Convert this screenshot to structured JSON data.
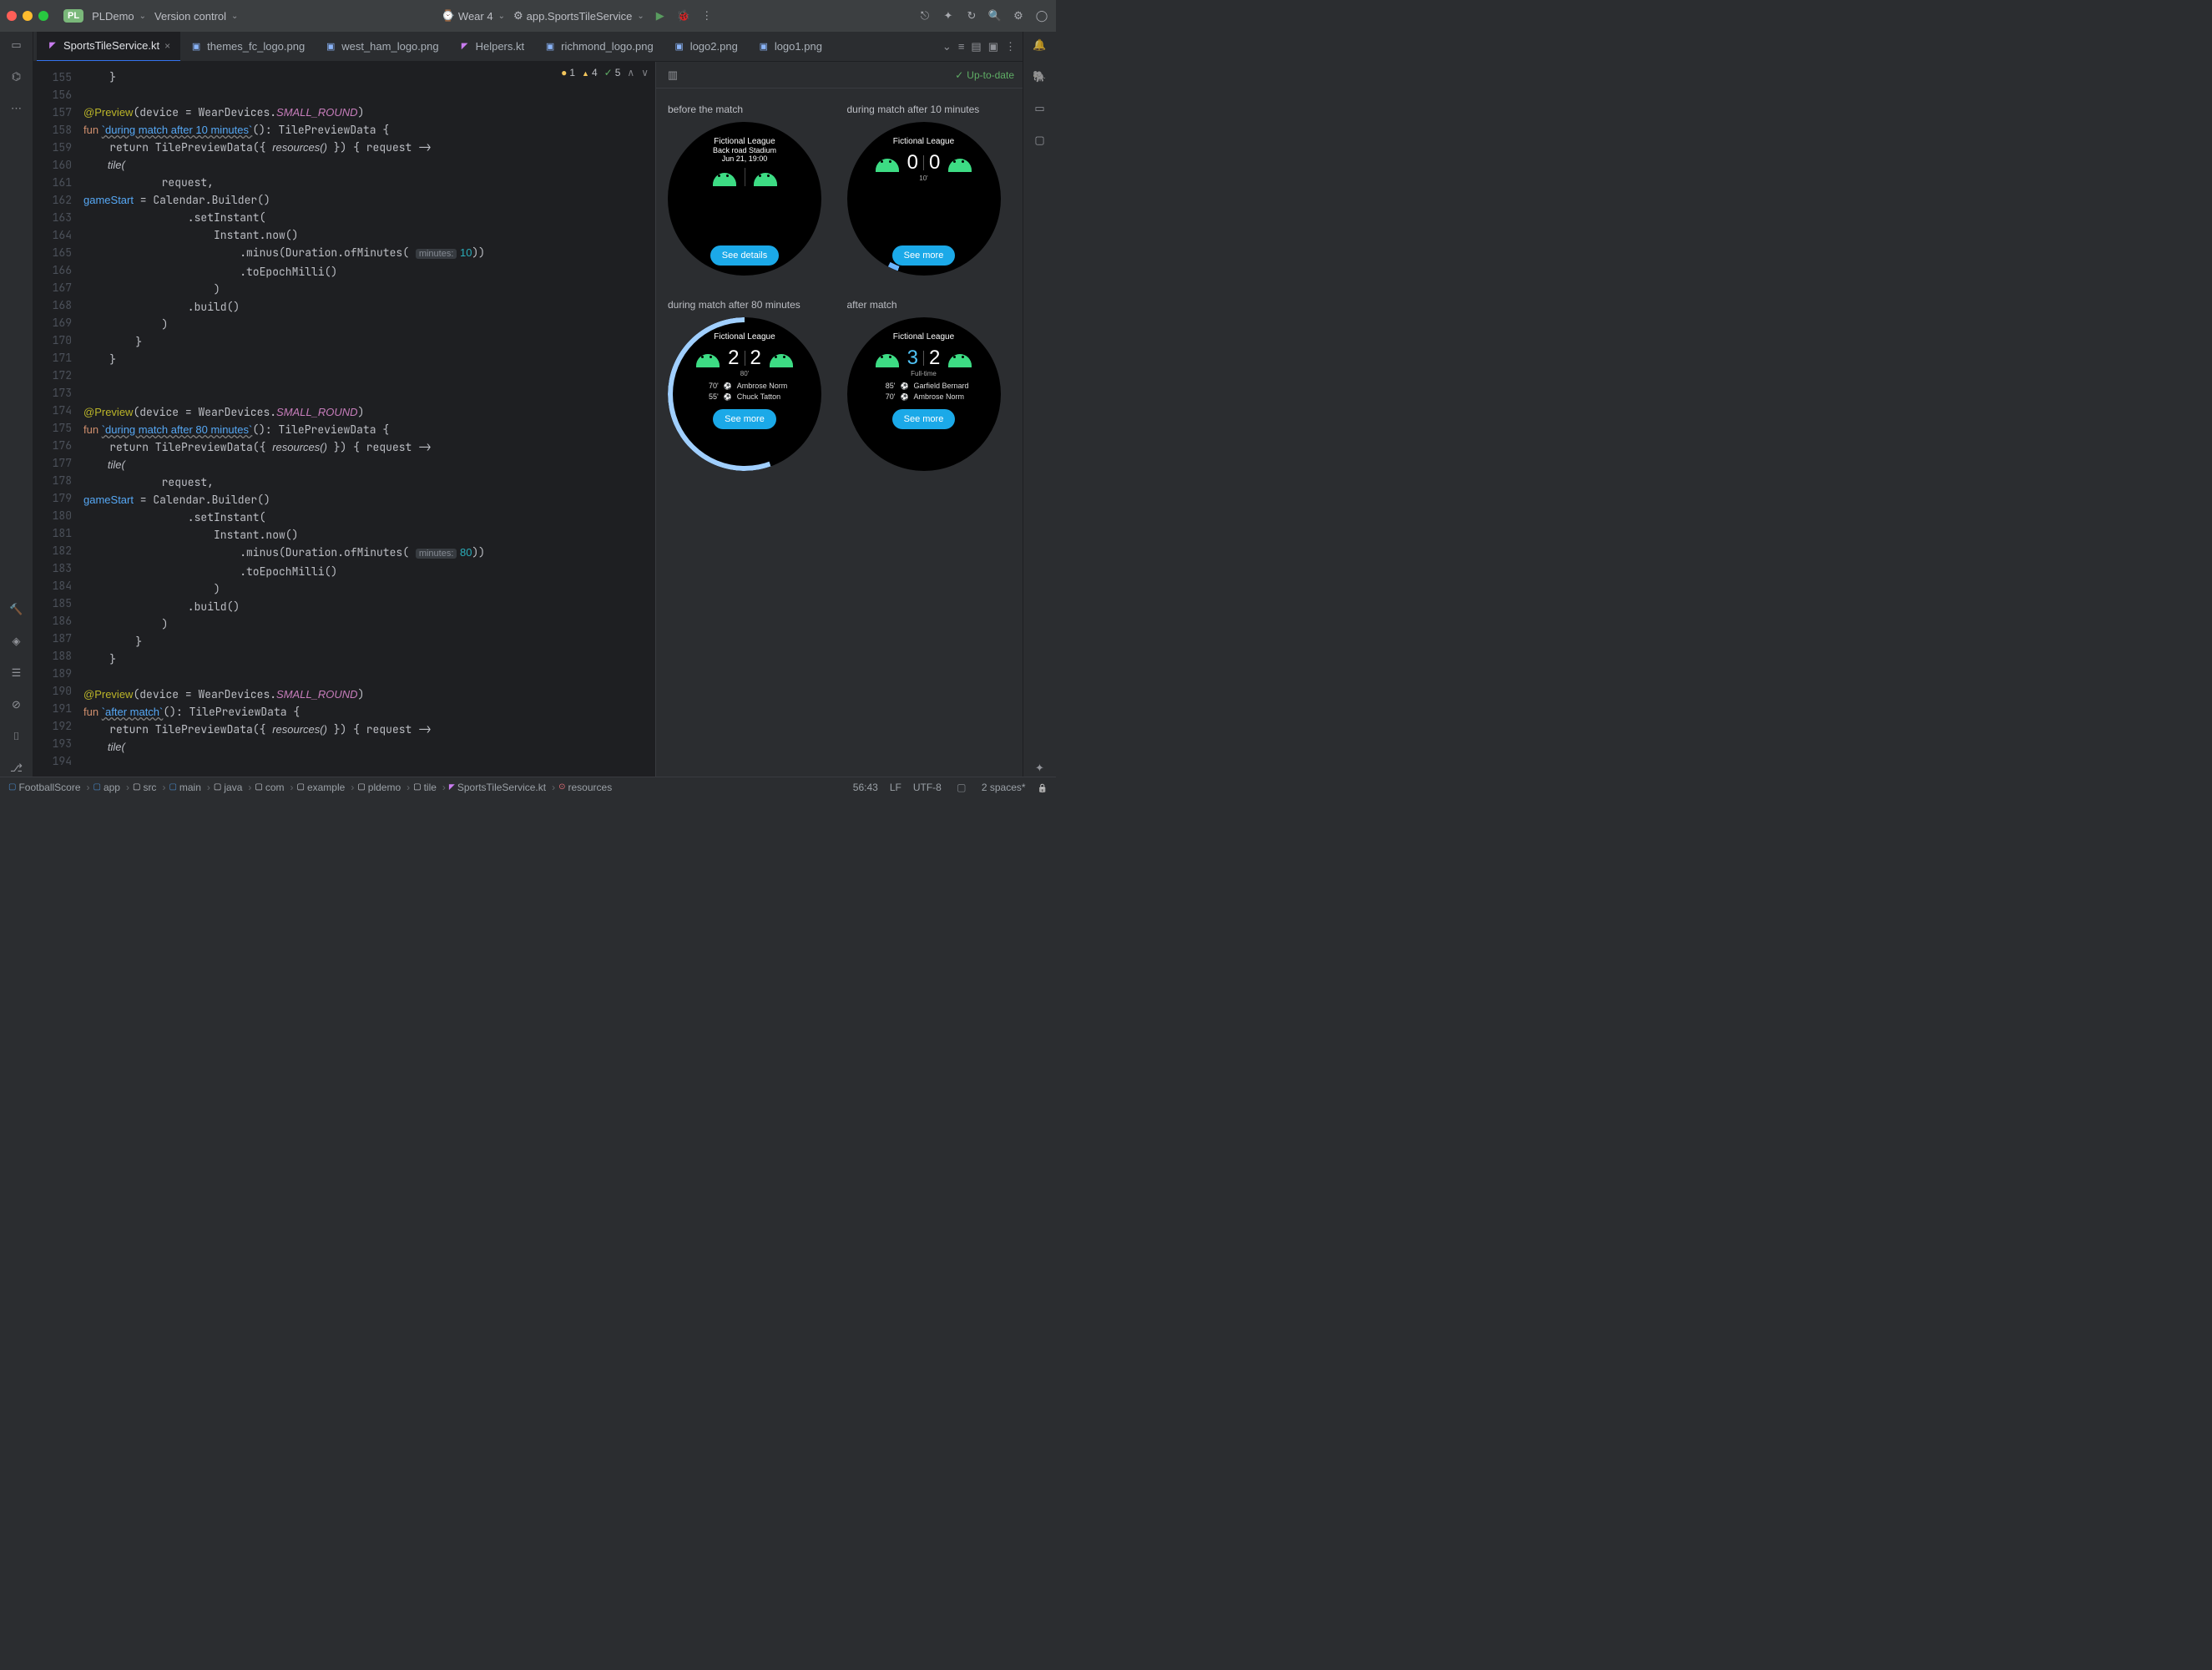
{
  "toolbar": {
    "project_badge": "PL",
    "project_name": "PLDemo",
    "vcs": "Version control",
    "device": "Wear 4",
    "run_config": "app.SportsTileService"
  },
  "tabs": [
    {
      "label": "SportsTileService.kt",
      "type": "kt",
      "active": true,
      "closeable": true
    },
    {
      "label": "themes_fc_logo.png",
      "type": "img"
    },
    {
      "label": "west_ham_logo.png",
      "type": "img"
    },
    {
      "label": "Helpers.kt",
      "type": "kt"
    },
    {
      "label": "richmond_logo.png",
      "type": "img"
    },
    {
      "label": "logo2.png",
      "type": "img"
    },
    {
      "label": "logo1.png",
      "type": "img"
    }
  ],
  "inspections": {
    "err": "1",
    "warn": "4",
    "ok": "5"
  },
  "gutter_start": 155,
  "gutter_end": 194,
  "preview": {
    "status": "Up-to-date",
    "cells": [
      {
        "label": "before the match",
        "league": "Fictional League",
        "stadium": "Back road Stadium",
        "date": "Jun 21, 19:00",
        "btn": "See details",
        "mode": "pre"
      },
      {
        "label": "during match after 10 minutes",
        "league": "Fictional League",
        "score_a": "0",
        "score_b": "0",
        "sub": "10'",
        "btn": "See more",
        "mode": "live",
        "arc": "arc-10"
      },
      {
        "label": "during match after 80 minutes",
        "league": "Fictional League",
        "score_a": "2",
        "score_b": "2",
        "sub": "80'",
        "btn": "See more",
        "mode": "live",
        "arc": "arc-80",
        "goals": [
          {
            "min": "70'",
            "name": "Ambrose Norm"
          },
          {
            "min": "55'",
            "name": "Chuck Tatton"
          }
        ]
      },
      {
        "label": "after match",
        "league": "Fictional League",
        "score_a": "3",
        "score_b": "2",
        "sub": "Full-time",
        "btn": "See more",
        "mode": "post",
        "score_a_class": "score-blue",
        "goals": [
          {
            "min": "85'",
            "name": "Garfield Bernard"
          },
          {
            "min": "70'",
            "name": "Ambrose Norm"
          }
        ]
      }
    ]
  },
  "breadcrumbs": [
    {
      "ic": "sq",
      "label": "FootballScore"
    },
    {
      "ic": "sq",
      "label": "app"
    },
    {
      "ic": "dir",
      "label": "src"
    },
    {
      "ic": "sq",
      "label": "main"
    },
    {
      "ic": "dir",
      "label": "java"
    },
    {
      "ic": "dir",
      "label": "com"
    },
    {
      "ic": "dir",
      "label": "example"
    },
    {
      "ic": "dir",
      "label": "pldemo"
    },
    {
      "ic": "dir",
      "label": "tile"
    },
    {
      "ic": "ktf",
      "label": "SportsTileService.kt"
    },
    {
      "ic": "fnc",
      "label": "resources"
    }
  ],
  "statusbar": {
    "pos": "56:43",
    "sep": "LF",
    "enc": "UTF-8",
    "indent": "2 spaces*"
  },
  "code_literals": {
    "preview_ann": "@Preview",
    "device_arg": "(device = WearDevices.",
    "small_round": "SMALL_ROUND",
    ")": ")",
    "fun": "fun ",
    "fn1": "`during match after 10 minutes`",
    "fn2": "`during match after 80 minutes`",
    "fn3": "`after match`",
    "sig": "(): TilePreviewData {",
    "return": "    return ",
    "tpd": "TilePreviewData({ ",
    "res_call": "resources()",
    "tpd2": " }) { request ->",
    "tile": "        tile(",
    "req": "            request,",
    "gs": "            gameStart",
    " eq": " = Calendar.Builder()",
    "si": "                .setInstant(",
    "now": "                    Instant.now()",
    "minus": "                        .minus(Duration.ofMinutes( ",
    "m_hint": "minutes:",
    "m10": " 10",
    "m80": " 80",
    "close": "))",
    "epoch": "                        .toEpochMilli()",
    "p": "                    )",
    "build": "                .build()",
    "p2": "            )",
    "cb": "        }",
    "cb2": "    }"
  }
}
